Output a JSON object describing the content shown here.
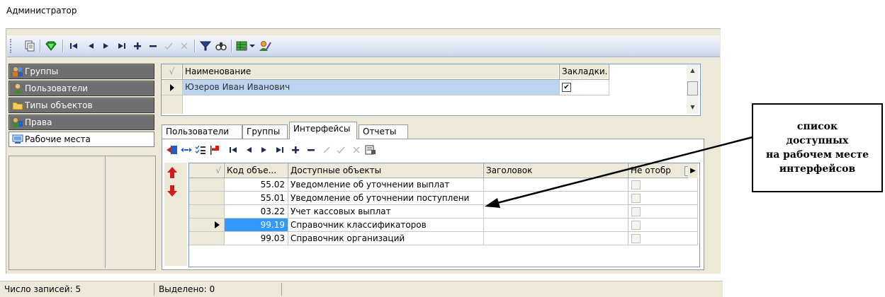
{
  "window": {
    "title": "Администратор"
  },
  "toolbar": {
    "icons": [
      "copy-icon",
      "gem-icon",
      "first-record-icon",
      "prev-record-icon",
      "next-record-icon",
      "last-record-icon",
      "add-record-icon",
      "delete-record-icon",
      "post-icon",
      "cancel-icon",
      "filter-icon",
      "find-icon",
      "grid-settings-icon",
      "dropdown-arrow-icon",
      "user-tools-icon"
    ]
  },
  "nav": {
    "items": [
      {
        "label": "Группы",
        "icon": "users-group-icon",
        "active": false
      },
      {
        "label": "Пользователи",
        "icon": "user-icon",
        "active": false
      },
      {
        "label": "Типы объектов",
        "icon": "folder-icon",
        "active": false
      },
      {
        "label": "Права",
        "icon": "rights-icon",
        "active": false
      },
      {
        "label": "Рабочие места",
        "icon": "workstation-icon",
        "active": true
      }
    ]
  },
  "grid_users": {
    "columns": [
      "Наименование",
      "Закладки."
    ],
    "rows": [
      {
        "name": "Юзеров Иван Иванович",
        "bookmarks": true
      }
    ]
  },
  "tabs": {
    "items": [
      "Пользователи",
      "Группы",
      "Интерфейсы",
      "Отчеты"
    ],
    "selected": "Интерфейсы"
  },
  "grid_interfaces": {
    "columns": [
      "Код объе...",
      "Доступные объекты",
      "Заголовок",
      "Не отобр"
    ],
    "rows": [
      {
        "code": "55.02",
        "object": "Уведомление об уточнении выплат",
        "title": "",
        "hidden": false,
        "current": false
      },
      {
        "code": "55.01",
        "object": "Уведомление об уточнении поступлени",
        "title": "",
        "hidden": false,
        "current": false
      },
      {
        "code": "03.22",
        "object": "Учет кассовых выплат",
        "title": "",
        "hidden": false,
        "current": false
      },
      {
        "code": "99.19",
        "object": "Справочник классификаторов",
        "title": "",
        "hidden": false,
        "current": true
      },
      {
        "code": "99.03",
        "object": "Справочник организаций",
        "title": "",
        "hidden": false,
        "current": false
      }
    ]
  },
  "status": {
    "records_label": "Число записей:",
    "records_value": "5",
    "selected_label": "Выделено:",
    "selected_value": "0"
  },
  "annotation": {
    "lines": [
      "список",
      "доступных",
      "на рабочем месте",
      "интерфейсов"
    ]
  },
  "colors": {
    "accent": "#3a6ea5",
    "selection": "#3399ff",
    "nav_inactive": "#6f6f6f"
  }
}
